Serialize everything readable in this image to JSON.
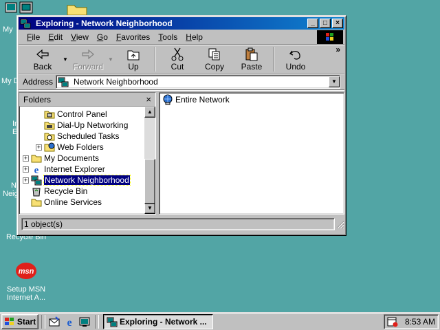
{
  "desktop": {
    "icons": [
      {
        "label_lines": [
          "My"
        ],
        "icon": "my-computer-icon"
      },
      {
        "label_lines": [
          "My D"
        ],
        "icon": "my-documents-icon"
      },
      {
        "label_lines": [
          "In",
          "E"
        ],
        "icon": "internet-explorer-icon"
      },
      {
        "label_lines": [
          "N",
          "Neigh"
        ],
        "icon": "network-neighborhood-icon"
      },
      {
        "label_lines": [
          "Recycle Bin"
        ],
        "icon": "recycle-bin-icon"
      },
      {
        "label_lines": [
          "Setup MSN",
          "Internet A..."
        ],
        "icon": "msn-icon"
      }
    ]
  },
  "window": {
    "title": "Exploring - Network Neighborhood",
    "controls": {
      "minimize": "_",
      "maximize": "□",
      "close": "×"
    },
    "menu": [
      "File",
      "Edit",
      "View",
      "Go",
      "Favorites",
      "Tools",
      "Help"
    ],
    "toolbar": {
      "back": "Back",
      "forward": "Forward",
      "up": "Up",
      "cut": "Cut",
      "copy": "Copy",
      "paste": "Paste",
      "undo": "Undo",
      "more": "»"
    },
    "address": {
      "label": "Address",
      "value": "Network Neighborhood"
    },
    "folders_pane": {
      "title": "Folders",
      "close": "×",
      "items": [
        {
          "label": "Control Panel",
          "icon": "control-panel-icon",
          "expander": ""
        },
        {
          "label": "Dial-Up Networking",
          "icon": "dialup-networking-icon",
          "expander": ""
        },
        {
          "label": "Scheduled Tasks",
          "icon": "scheduled-tasks-icon",
          "expander": ""
        },
        {
          "label": "Web Folders",
          "icon": "web-folders-icon",
          "expander": "+"
        },
        {
          "label": "My Documents",
          "icon": "folder-icon",
          "expander": "+"
        },
        {
          "label": "Internet Explorer",
          "icon": "internet-explorer-icon",
          "expander": "+"
        },
        {
          "label": "Network Neighborhood",
          "icon": "network-neighborhood-icon",
          "expander": "+",
          "selected": true
        },
        {
          "label": "Recycle Bin",
          "icon": "recycle-bin-icon",
          "expander": ""
        },
        {
          "label": "Online Services",
          "icon": "folder-icon",
          "expander": ""
        }
      ]
    },
    "content_items": [
      {
        "label": "Entire Network",
        "icon": "entire-network-icon"
      }
    ],
    "status": "1 object(s)"
  },
  "taskbar": {
    "start_label": "Start",
    "task_label": "Exploring - Network ...",
    "clock": "8:53 AM"
  },
  "colors": {
    "desktop": "#52a5a5",
    "titlebar_start": "#000080",
    "titlebar_end": "#1084d0",
    "selection": "#000080",
    "face": "#c0c0c0"
  }
}
